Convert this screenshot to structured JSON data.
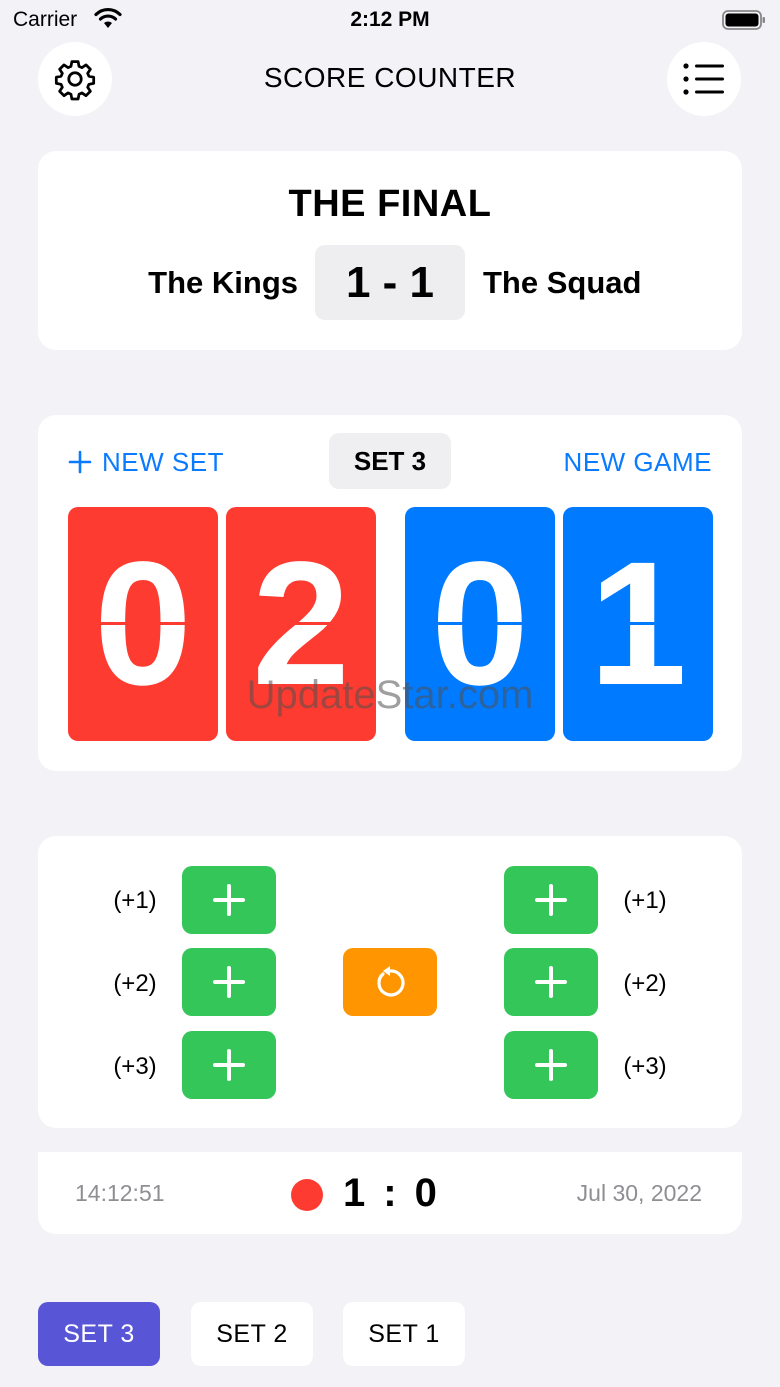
{
  "status": {
    "carrier": "Carrier",
    "time": "2:12 PM"
  },
  "header": {
    "title": "SCORE COUNTER",
    "settings_icon": "gear-icon",
    "list_icon": "list-icon"
  },
  "match": {
    "title": "THE FINAL",
    "team_left": "The Kings",
    "team_right": "The Squad",
    "score": "1 - 1"
  },
  "set_panel": {
    "new_set_label": "NEW SET",
    "set_label": "SET 3",
    "new_game_label": "NEW GAME",
    "left_digits": [
      "0",
      "2"
    ],
    "right_digits": [
      "0",
      "1"
    ],
    "watermark": "UpdateStar.com",
    "colors": {
      "left": "#fe3b30",
      "right": "#007aff",
      "accent": "#0a7bff"
    }
  },
  "controls": {
    "increments": [
      "(+1)",
      "(+2)",
      "(+3)"
    ],
    "plus_color": "#34c659",
    "undo_color": "#ff9500"
  },
  "history": {
    "time": "14:12:51",
    "score_left": "1",
    "separator": ":",
    "score_right": "0",
    "date": "Jul 30, 2022"
  },
  "set_tabs": [
    "SET 3",
    "SET 2",
    "SET 1"
  ],
  "active_tab": "SET 3",
  "active_color": "#5856d6"
}
